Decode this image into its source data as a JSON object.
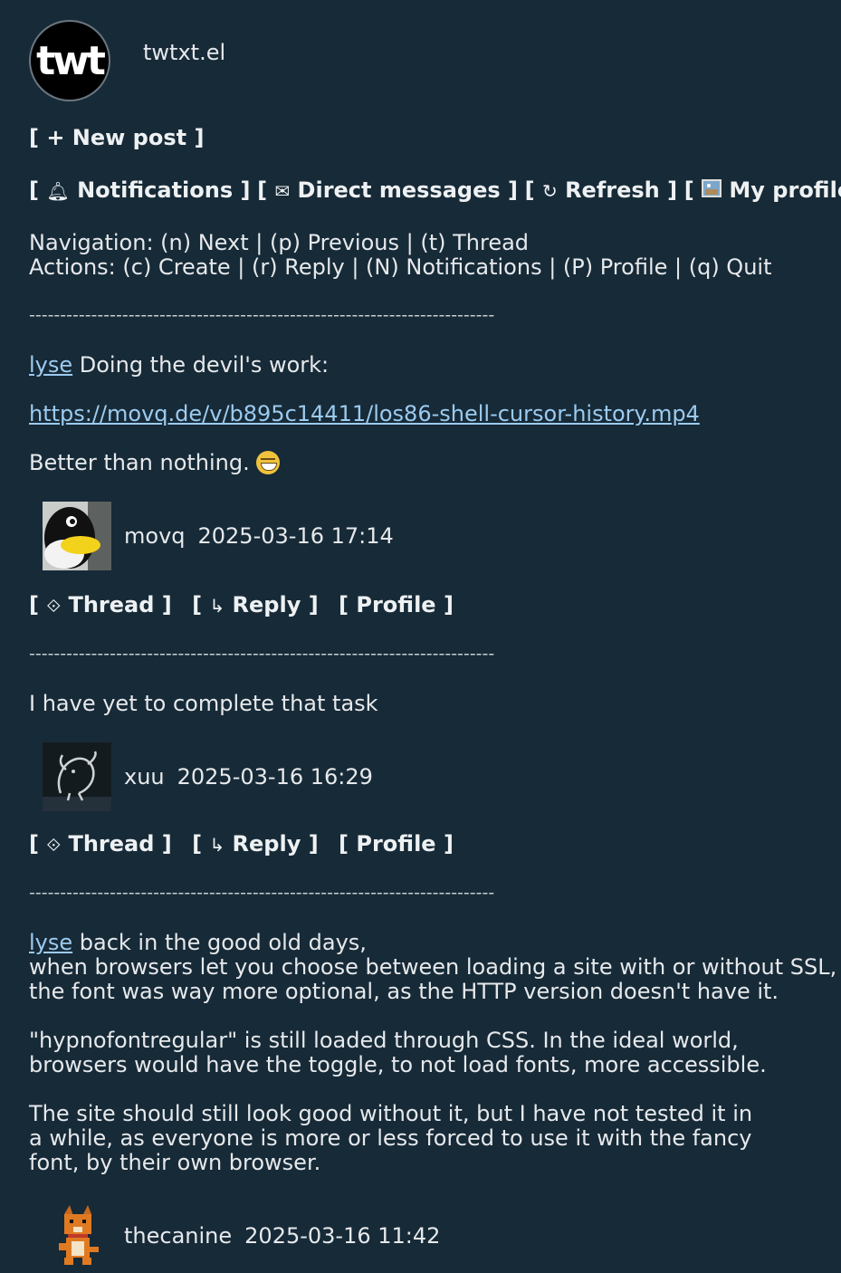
{
  "app": {
    "logo_text": "twt",
    "name": "twtxt.el"
  },
  "toolbar": {
    "new_post": "[ + New post ]",
    "notifications": "Notifications",
    "direct_messages": "Direct messages",
    "refresh": "Refresh",
    "my_profile": "My profile"
  },
  "help": {
    "navigation": "Navigation: (n) Next | (p) Previous | (t) Thread",
    "actions": "Actions: (c) Create | (r) Reply | (N) Notifications | (P) Profile | (q) Quit"
  },
  "separator": "---------------------------------------------------------------------------",
  "labels": {
    "thread": "Thread",
    "reply": "Reply",
    "profile": "Profile"
  },
  "posts": [
    {
      "mention": "lyse",
      "line1": " Doing the devil's work:",
      "url": "https://movq.de/v/b895c14411/los86-shell-cursor-history.mp4",
      "line3": "Better than nothing. ",
      "author": "movq",
      "timestamp": "2025-03-16 17:14"
    },
    {
      "line1": "I have yet to complete that task",
      "author": "xuu",
      "timestamp": "2025-03-16 16:29"
    },
    {
      "mention": "lyse",
      "line1": " back in the good old days,",
      "line2": "when browsers let you choose between loading a site with or without SSL,",
      "line3": "the font was way more optional, as the HTTP version doesn't have it.",
      "line4": "\"hypnofontregular\" is still loaded through CSS. In the ideal world,",
      "line5": "browsers would have the toggle, to not load fonts, more accessible.",
      "line6": "The site should still look good without it, but I have not tested it in",
      "line7": "a while, as everyone is more or less forced to use it with the fancy",
      "line8": "font, by their own browser.",
      "author": "thecanine",
      "timestamp": "2025-03-16 11:42"
    }
  ]
}
